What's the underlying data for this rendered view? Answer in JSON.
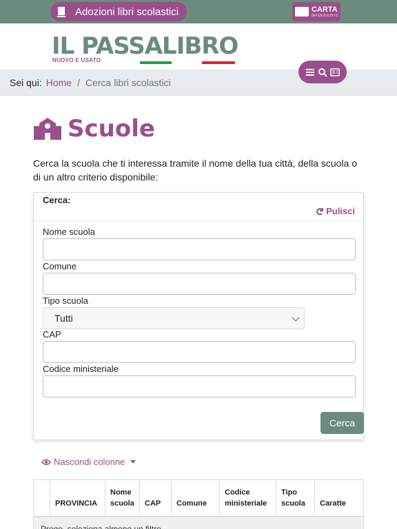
{
  "topbar": {
    "adozioni_label": "Adozioni libri scolastici",
    "carta_main": "CARTA",
    "carta_sub": "del DOCENTE"
  },
  "header": {
    "logo_title": "IL PASSALIBRO",
    "logo_sub": "NUOVO E USATO"
  },
  "breadcrumb": {
    "label": "Sei qui:",
    "home": "Home",
    "current": "Cerca libri scolastici"
  },
  "page": {
    "title": "Scuole",
    "intro": "Cerca la scuola che ti interessa tramite il nome della tua città, della scuola o di un altro criterio disponibile:"
  },
  "search": {
    "heading": "Cerca:",
    "clear_label": "Pulisci",
    "fields": [
      {
        "label": "Nome scuola",
        "value": ""
      },
      {
        "label": "Comune",
        "value": ""
      },
      {
        "label": "Tipo scuola",
        "value": "Tutti"
      },
      {
        "label": "CAP",
        "value": ""
      },
      {
        "label": "Codice ministeriale",
        "value": ""
      }
    ],
    "submit_label": "Cerca"
  },
  "columns_toggle": "Nascondi colonne",
  "table": {
    "headers": [
      "",
      "PROVINCIA",
      "Nome scuola",
      "CAP",
      "Comune",
      "Codice ministeriale",
      "Tipo scuola",
      "Caratte"
    ],
    "empty_message": "Prego, seleziona almeno un filtro"
  },
  "colors": {
    "brand_purple": "#9b4e8c",
    "brand_green": "#6b8c7d"
  }
}
